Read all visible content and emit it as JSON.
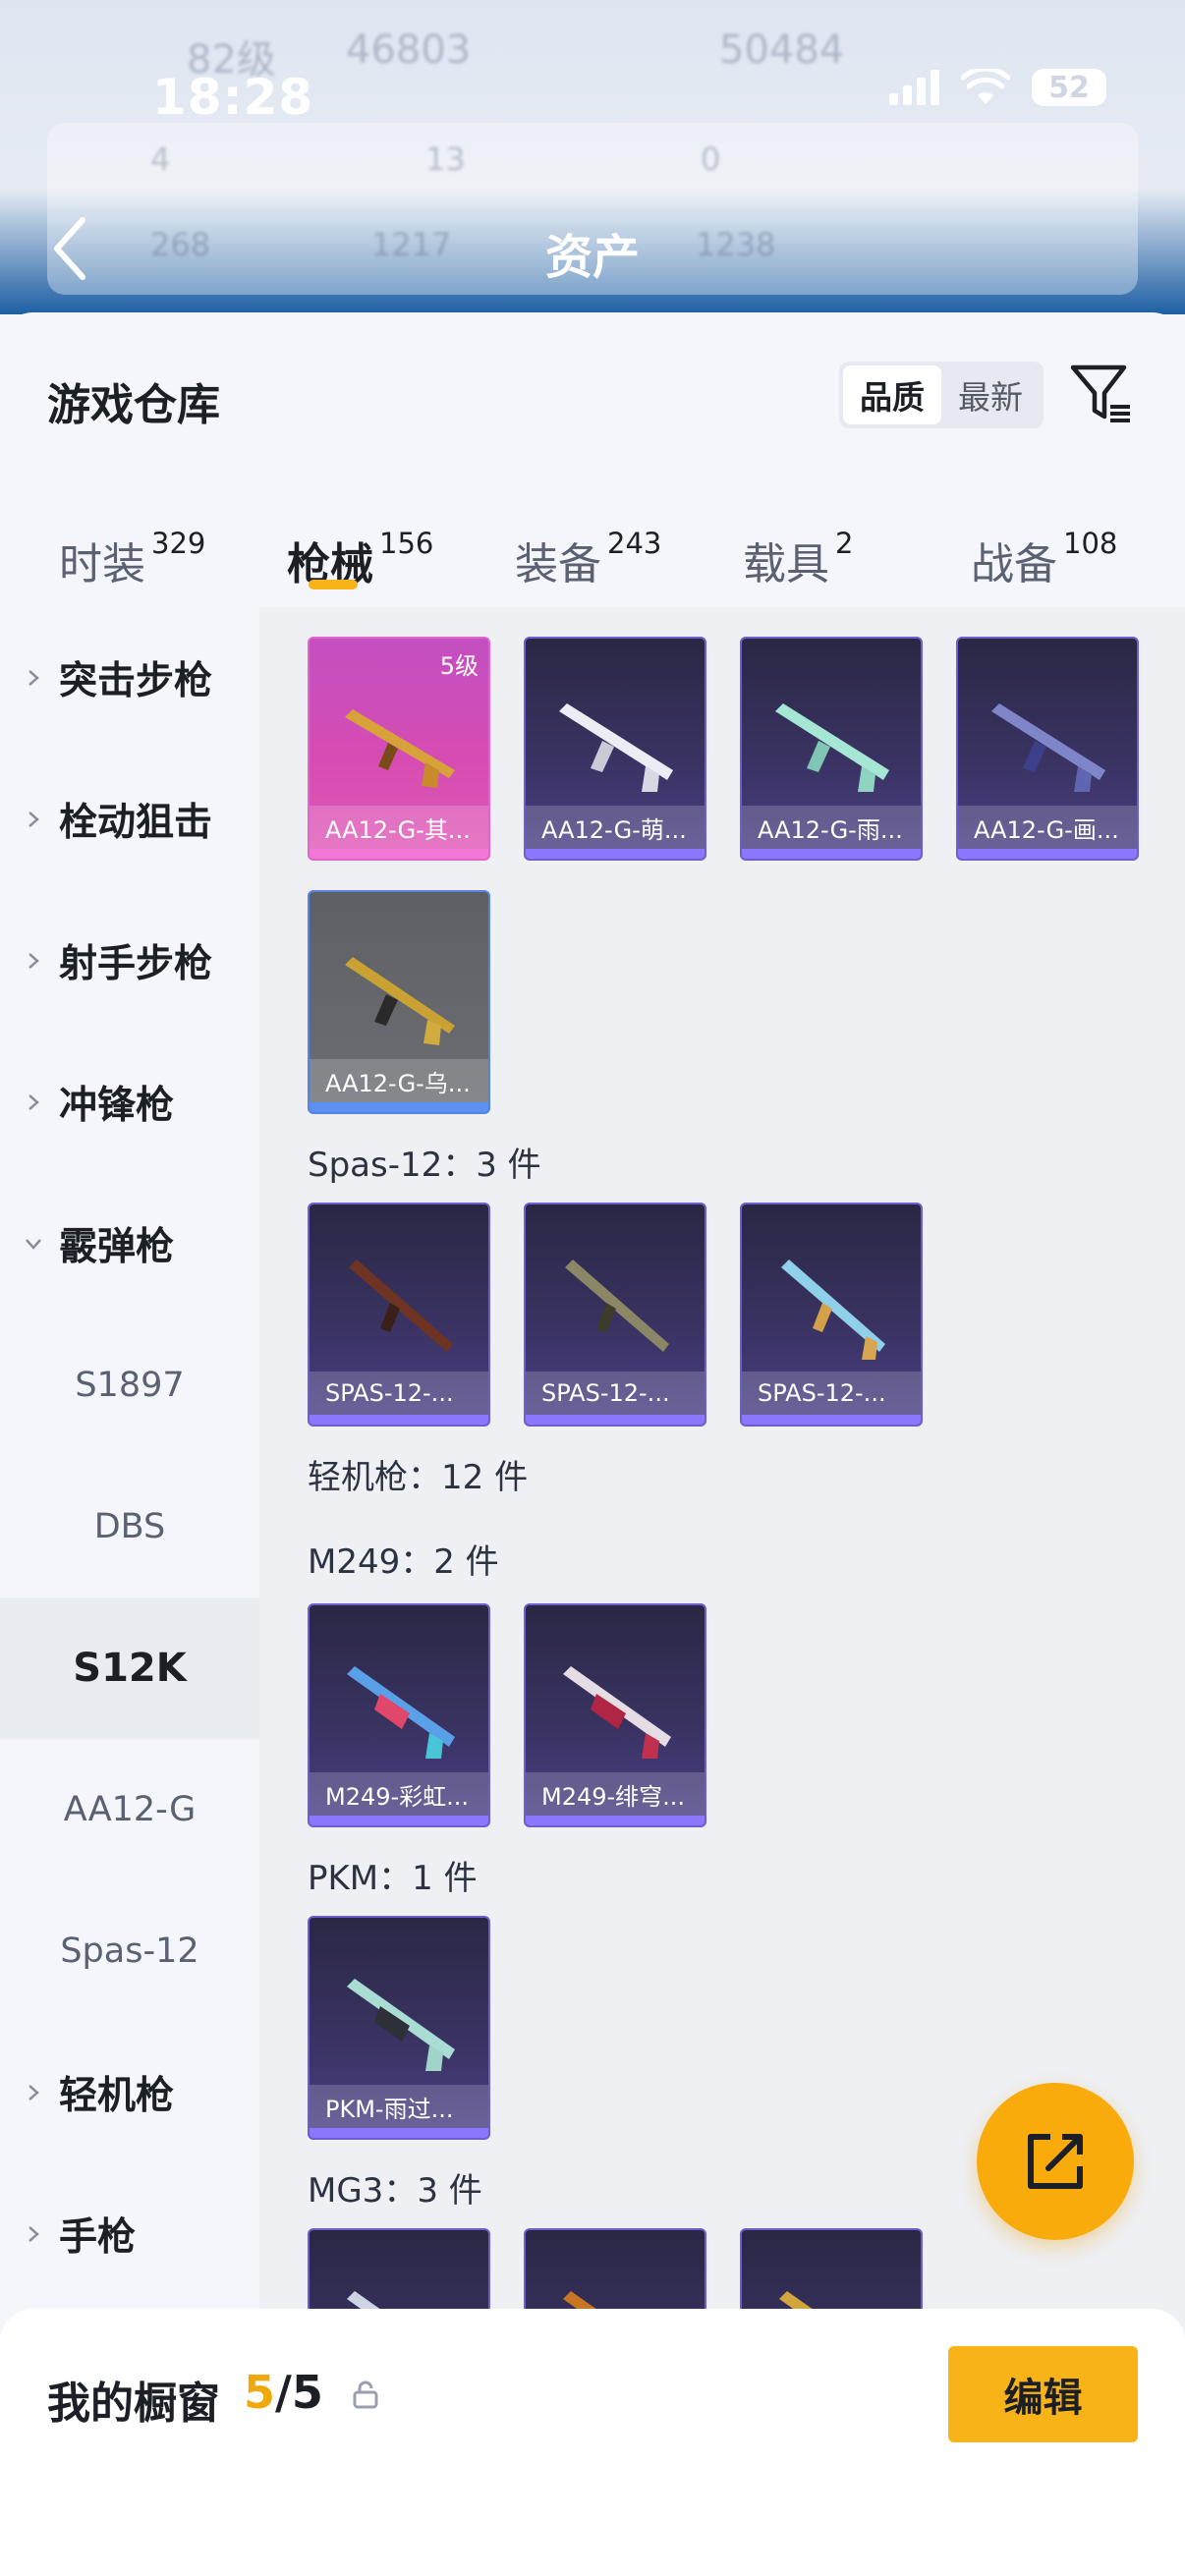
{
  "status_bar": {
    "time": "18:28",
    "battery": "52"
  },
  "header": {
    "title": "资产",
    "blurred": {
      "level": "82级",
      "coins_a": "46803",
      "coins_b": "50484",
      "s1": "4",
      "s2": "13",
      "s3": "0",
      "s4": "268",
      "s5": "1217",
      "s6": "1238"
    }
  },
  "sheet": {
    "title": "游戏仓库"
  },
  "sort": {
    "quality": "品质",
    "latest": "最新"
  },
  "tabs": [
    {
      "label": "时装",
      "count": "329"
    },
    {
      "label": "枪械",
      "count": "156"
    },
    {
      "label": "装备",
      "count": "243"
    },
    {
      "label": "载具",
      "count": "2"
    },
    {
      "label": "战备",
      "count": "108"
    }
  ],
  "sidebar": [
    {
      "label": "突击步枪"
    },
    {
      "label": "栓动狙击"
    },
    {
      "label": "射手步枪"
    },
    {
      "label": "冲锋枪"
    },
    {
      "label": "霰弹枪"
    },
    {
      "label": "S1897"
    },
    {
      "label": "DBS"
    },
    {
      "label": "S12K"
    },
    {
      "label": "AA12-G"
    },
    {
      "label": "Spas-12"
    },
    {
      "label": "轻机枪"
    },
    {
      "label": "手枪"
    }
  ],
  "groups": {
    "spas": "Spas-12：3 件",
    "lmg": "轻机枪：12 件",
    "m249": "M249：2 件",
    "pkm": "PKM：1 件",
    "mg3": "MG3：3 件"
  },
  "cards": {
    "aa12_1": {
      "name": "AA12-G-其...",
      "tag": "5级"
    },
    "aa12_2": {
      "name": "AA12-G-萌..."
    },
    "aa12_3": {
      "name": "AA12-G-雨..."
    },
    "aa12_4": {
      "name": "AA12-G-画..."
    },
    "aa12_5": {
      "name": "AA12-G-乌..."
    },
    "spas_1": {
      "name": "SPAS-12-..."
    },
    "spas_2": {
      "name": "SPAS-12-..."
    },
    "spas_3": {
      "name": "SPAS-12-..."
    },
    "m249_1": {
      "name": "M249-彩虹..."
    },
    "m249_2": {
      "name": "M249-绯穹..."
    },
    "pkm_1": {
      "name": "PKM-雨过..."
    }
  },
  "showcase": {
    "label": "我的橱窗",
    "current": "5",
    "sep_total": "/5",
    "edit": "编辑"
  },
  "colors": {
    "accent": "#f7b318",
    "rarity_purple": "#6b5fd0",
    "rarity_pink": "#e266c9",
    "rarity_gray": "#5883e6"
  }
}
